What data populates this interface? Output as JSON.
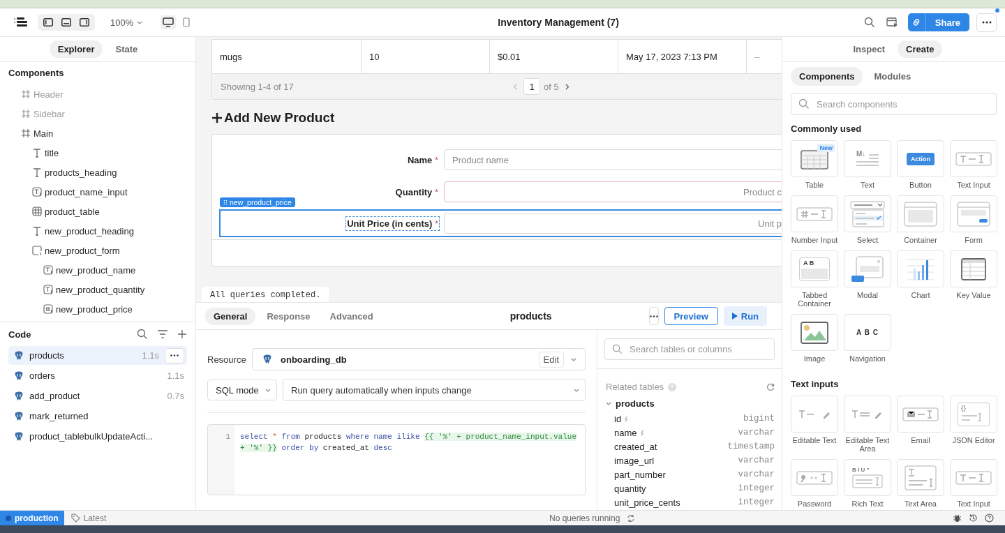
{
  "header": {
    "zoom": "100%",
    "title": "Inventory Management (7)",
    "share": "Share"
  },
  "explorer": {
    "tabs": [
      {
        "label": "Explorer",
        "selected": true
      },
      {
        "label": "State",
        "selected": false
      }
    ],
    "components_title": "Components",
    "tree": [
      {
        "label": "Header",
        "kind": "frame",
        "hidden": true
      },
      {
        "label": "Sidebar",
        "kind": "frame",
        "hidden": true
      },
      {
        "label": "Main",
        "kind": "frame",
        "hidden": false,
        "children": [
          {
            "label": "title",
            "kind": "text",
            "hidden": false
          },
          {
            "label": "products_heading",
            "kind": "text",
            "hidden": false
          },
          {
            "label": "product_name_input",
            "kind": "text_input",
            "hidden": false
          },
          {
            "label": "product_table",
            "kind": "table",
            "hidden": false
          },
          {
            "label": "new_product_heading",
            "kind": "text",
            "hidden": false
          },
          {
            "label": "new_product_form",
            "kind": "form",
            "hidden": false,
            "children": [
              {
                "label": "new_product_name",
                "kind": "text_input",
                "hidden": false
              },
              {
                "label": "new_product_quantity",
                "kind": "text_input",
                "hidden": false
              },
              {
                "label": "new_product_price",
                "kind": "number_input",
                "hidden": false
              }
            ]
          }
        ]
      }
    ],
    "code_title": "Code",
    "queries": [
      {
        "name": "products",
        "time": "1.1s",
        "selected": true
      },
      {
        "name": "orders",
        "time": "1.1s",
        "selected": false
      },
      {
        "name": "add_product",
        "time": "0.7s",
        "selected": false
      },
      {
        "name": "mark_returned",
        "selected": false
      },
      {
        "name": "product_tablebulkUpdateActi...",
        "selected": false
      }
    ]
  },
  "canvas": {
    "table": {
      "row": [
        "mugs",
        "10",
        "$0.01",
        "May 17, 2023 7:13 PM",
        "–"
      ],
      "summary": "Showing 1-4 of 17",
      "page": "1",
      "page_total": "of 5"
    },
    "heading": "Add New Product",
    "form": {
      "fields": [
        {
          "label": "Name",
          "required_mark": "*",
          "placeholder": "Product name",
          "kind": "text",
          "invalid": false,
          "selected": false
        },
        {
          "label": "Quantity",
          "required_mark": "*",
          "placeholder": "Product c",
          "kind": "number",
          "invalid": true,
          "selected": false
        },
        {
          "label": "Unit Price (in cents)",
          "required_mark": "*",
          "placeholder": "Unit p",
          "kind": "number",
          "invalid": false,
          "selected": true
        }
      ]
    },
    "selection_tag": "new_product_price"
  },
  "console": {
    "message": "All queries completed."
  },
  "query": {
    "tabs": [
      {
        "label": "General",
        "selected": true
      },
      {
        "label": "Response",
        "selected": false
      },
      {
        "label": "Advanced",
        "selected": false
      }
    ],
    "name": "products",
    "preview": "Preview",
    "run": "Run",
    "resource_label": "Resource",
    "resource": "onboarding_db",
    "edit": "Edit",
    "mode": "SQL mode",
    "trigger": "Run query automatically when inputs change",
    "lines": [
      {
        "number": "1",
        "tokens": [
          {
            "text": "select",
            "kind": "keyword"
          },
          {
            "text": "*",
            "kind": "operator"
          },
          {
            "text": "from",
            "kind": "keyword"
          },
          {
            "text": "products",
            "kind": "plain"
          },
          {
            "text": "where",
            "kind": "keyword"
          },
          {
            "text": "name",
            "kind": "keyword"
          },
          {
            "text": "ilike",
            "kind": "keyword"
          },
          {
            "text": "{{ '%' + product_name_input.value + '%' }}",
            "kind": "template"
          },
          {
            "text": "order",
            "kind": "keyword"
          },
          {
            "text": "by",
            "kind": "keyword"
          },
          {
            "text": "created_at",
            "kind": "plain"
          },
          {
            "text": "desc",
            "kind": "keyword"
          }
        ]
      }
    ]
  },
  "schema": {
    "search_placeholder": "Search tables or columns",
    "title": "Related tables",
    "tables": [
      {
        "name": "products",
        "expanded": true,
        "columns": [
          {
            "name": "id",
            "type": "bigint",
            "indexed": true
          },
          {
            "name": "name",
            "type": "varchar",
            "indexed": true
          },
          {
            "name": "created_at",
            "type": "timestamp",
            "indexed": false
          },
          {
            "name": "image_url",
            "type": "varchar",
            "indexed": false
          },
          {
            "name": "part_number",
            "type": "varchar",
            "indexed": false
          },
          {
            "name": "quantity",
            "type": "integer",
            "indexed": false
          },
          {
            "name": "unit_price_cents",
            "type": "integer",
            "indexed": false
          }
        ]
      }
    ]
  },
  "create_panel": {
    "tabs": [
      {
        "label": "Inspect",
        "selected": false
      },
      {
        "label": "Create",
        "selected": true
      }
    ],
    "subtabs": [
      {
        "label": "Components",
        "selected": true
      },
      {
        "label": "Modules",
        "selected": false
      }
    ],
    "search_placeholder": "Search components",
    "sections": [
      {
        "title": "Commonly used",
        "items": [
          {
            "label": "Table",
            "kind": "table",
            "badge": "New"
          },
          {
            "label": "Text",
            "kind": "text",
            "icon_text": "M↓"
          },
          {
            "label": "Button",
            "kind": "button",
            "icon_text": "Action"
          },
          {
            "label": "Text Input",
            "kind": "text_input"
          },
          {
            "label": "Number Input",
            "kind": "number_input"
          },
          {
            "label": "Select",
            "kind": "select"
          },
          {
            "label": "Container",
            "kind": "container"
          },
          {
            "label": "Form",
            "kind": "form"
          },
          {
            "label": "Tabbed Container",
            "kind": "tabbed",
            "icon_text": "A B"
          },
          {
            "label": "Modal",
            "kind": "modal"
          },
          {
            "label": "Chart",
            "kind": "chart"
          },
          {
            "label": "Key Value",
            "kind": "key_value"
          },
          {
            "label": "Image",
            "kind": "image"
          },
          {
            "label": "Navigation",
            "kind": "navigation",
            "icon_text": "A B C"
          }
        ]
      },
      {
        "title": "Text inputs",
        "items": [
          {
            "label": "Editable Text",
            "kind": "editable_text"
          },
          {
            "label": "Editable Text Area",
            "kind": "editable_text_area"
          },
          {
            "label": "Email",
            "kind": "email"
          },
          {
            "label": "JSON Editor",
            "kind": "json",
            "icon_text": "{}"
          },
          {
            "label": "Password",
            "kind": "password"
          },
          {
            "label": "Rich Text",
            "kind": "rich_text",
            "icon_text": "B I U ”"
          },
          {
            "label": "Text Area",
            "kind": "text_area"
          },
          {
            "label": "Text Input",
            "kind": "text_input"
          }
        ]
      }
    ]
  },
  "status_bar": {
    "environment": "production",
    "version": "Latest",
    "activity": "No queries running"
  }
}
